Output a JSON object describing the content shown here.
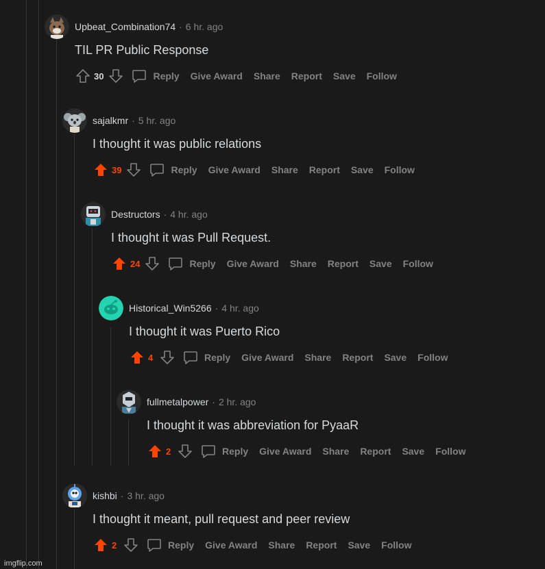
{
  "colors": {
    "background": "#1a1a1b",
    "upvoted": "#ff4500",
    "muted": "#818384",
    "text": "#d7dadc"
  },
  "actions": {
    "reply": "Reply",
    "give_award": "Give Award",
    "share": "Share",
    "report": "Report",
    "save": "Save",
    "follow": "Follow"
  },
  "comments": [
    {
      "author": "Upbeat_Combination74",
      "time": "6 hr. ago",
      "body": "TIL PR Public Response",
      "score": "30",
      "upvoted": false,
      "avatar": "dog-avatar"
    },
    {
      "author": "sajalkmr",
      "time": "5 hr. ago",
      "body": "I thought it was public relations",
      "score": "39",
      "upvoted": true,
      "avatar": "koala-avatar"
    },
    {
      "author": "Destructors",
      "time": "4 hr. ago",
      "body": "I thought it was Pull Request.",
      "score": "24",
      "upvoted": true,
      "avatar": "robot-avatar"
    },
    {
      "author": "Historical_Win5266",
      "time": "4 hr. ago",
      "body": "I thought it was Puerto Rico",
      "score": "4",
      "upvoted": true,
      "avatar": "snoo-avatar"
    },
    {
      "author": "fullmetalpower",
      "time": "2 hr. ago",
      "body": "I thought it was abbreviation for PyaaR",
      "score": "2",
      "upvoted": true,
      "avatar": "armor-avatar"
    },
    {
      "author": "kishbi",
      "time": "3 hr. ago",
      "body": "I thought it meant, pull request and peer review",
      "score": "2",
      "upvoted": true,
      "avatar": "blue-robot-avatar"
    }
  ],
  "watermark": "imgflip.com"
}
